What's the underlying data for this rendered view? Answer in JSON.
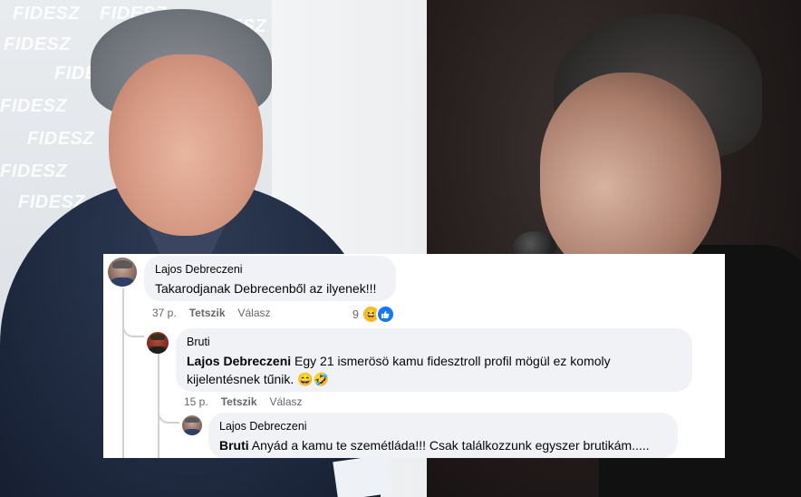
{
  "photo": {
    "watermark_text": "FIDESZ"
  },
  "comments": [
    {
      "author": "Lajos Debreczeni",
      "text": "Takarodjanak Debrecenből az ilyenek!!!",
      "time": "37 p.",
      "like_label": "Tetszik",
      "reply_label": "Válasz",
      "reaction_count": "9",
      "reactions": [
        "haha-icon",
        "like-icon"
      ]
    },
    {
      "author": "Bruti",
      "mention": "Lajos Debreczeni",
      "text": " Egy 21 ismerösö kamu fidesztroll profil mögül ez komoly kijelentésnek tűnik. 😄🤣",
      "time": "15 p.",
      "like_label": "Tetszik",
      "reply_label": "Válasz"
    },
    {
      "author": "Lajos Debreczeni",
      "mention": "Bruti",
      "text": " Anyád a kamu te szemétláda!!! Csak találkozzunk egyszer brutikám....."
    }
  ],
  "colors": {
    "bubble_bg": "#f0f2f5",
    "meta_text": "#65676b",
    "like_blue": "#1877f2",
    "haha_yellow": "#f7b928"
  }
}
